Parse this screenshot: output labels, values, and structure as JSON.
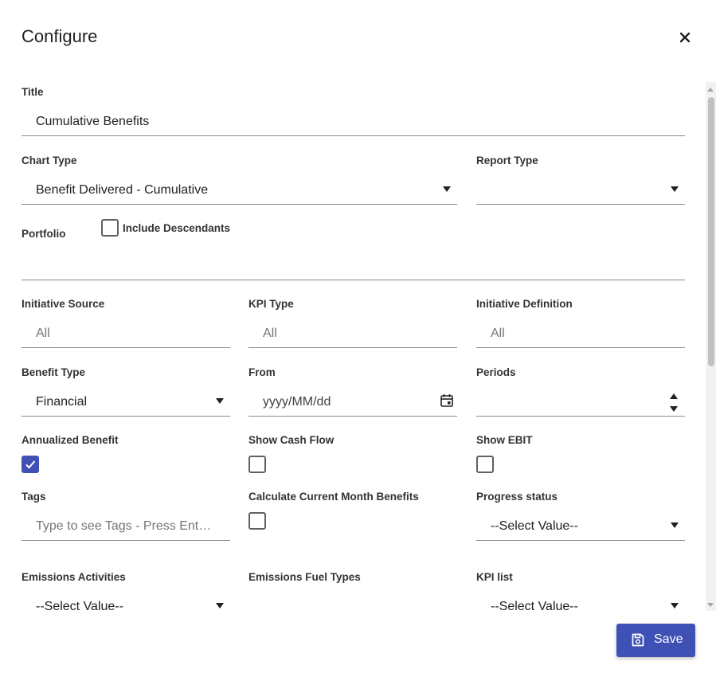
{
  "dialog": {
    "title": "Configure",
    "close_icon": "close-icon",
    "save_label": "Save",
    "save_icon": "floppy-disk-icon",
    "accent_color": "#3f51b5"
  },
  "fields": {
    "title": {
      "label": "Title",
      "value": "Cumulative Benefits"
    },
    "chart_type": {
      "label": "Chart Type",
      "value": "Benefit Delivered - Cumulative"
    },
    "report_type": {
      "label": "Report Type",
      "value": ""
    },
    "portfolio": {
      "label": "Portfolio",
      "value": ""
    },
    "include_descendants": {
      "label": "Include Descendants",
      "checked": false
    },
    "initiative_source": {
      "label": "Initiative Source",
      "placeholder": "All"
    },
    "kpi_type": {
      "label": "KPI Type",
      "placeholder": "All"
    },
    "initiative_definition": {
      "label": "Initiative Definition",
      "placeholder": "All"
    },
    "benefit_type": {
      "label": "Benefit Type",
      "value": "Financial"
    },
    "from": {
      "label": "From",
      "placeholder": "yyyy/MM/dd"
    },
    "periods": {
      "label": "Periods",
      "value": ""
    },
    "annualized_benefit": {
      "label": "Annualized Benefit",
      "checked": true
    },
    "show_cash_flow": {
      "label": "Show Cash Flow",
      "checked": false
    },
    "show_ebit": {
      "label": "Show EBIT",
      "checked": false
    },
    "tags": {
      "label": "Tags",
      "placeholder": "Type to see Tags - Press Enter ..."
    },
    "calculate_current_month": {
      "label": "Calculate Current Month Benefits",
      "checked": false
    },
    "progress_status": {
      "label": "Progress status",
      "value": "--Select Value--"
    },
    "emissions_activities": {
      "label": "Emissions Activities",
      "value": "--Select Value--"
    },
    "emissions_fuel_types": {
      "label": "Emissions Fuel Types",
      "value": ""
    },
    "kpi_list": {
      "label": "KPI list",
      "value": "--Select Value--"
    }
  }
}
